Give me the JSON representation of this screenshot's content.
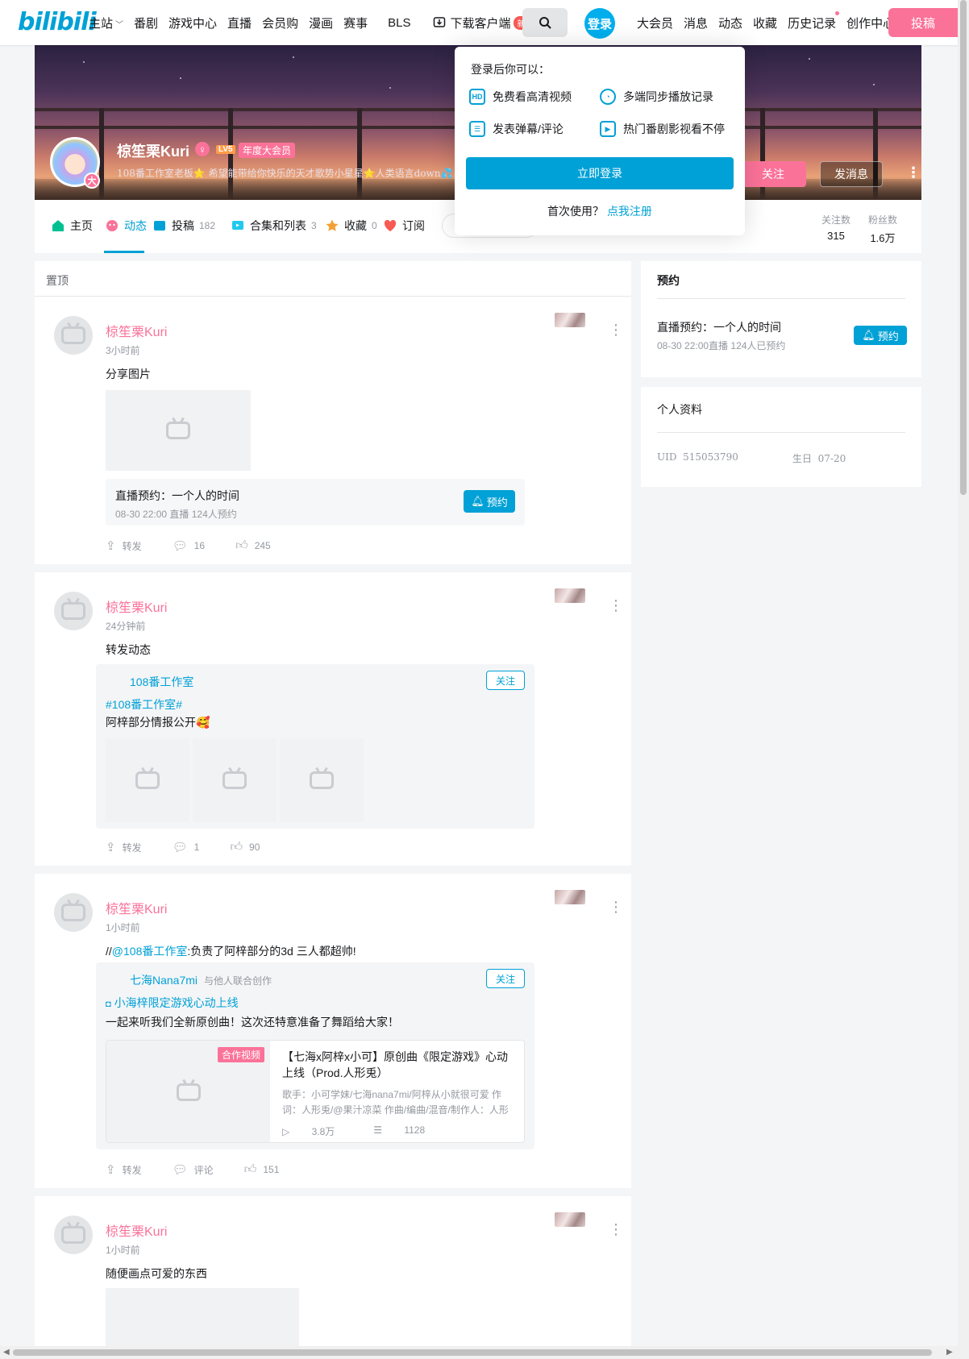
{
  "nav": {
    "logo": "bilibili",
    "left_items": [
      "主站",
      "番剧",
      "游戏中心",
      "直播",
      "会员购",
      "漫画",
      "赛事",
      "BLS"
    ],
    "download": "下载客户端",
    "new_badge": "新",
    "login": "登录",
    "right_items": [
      "大会员",
      "消息",
      "动态",
      "收藏",
      "历史记录",
      "创作中心"
    ],
    "upload": "投稿"
  },
  "profile": {
    "name": "椋笙栗Kuri",
    "level": "LV5",
    "vip": "年度大会员",
    "avatar_badge": "大",
    "sign": "108番工作室老板⭐ 希望能带给你快乐的天才歌势小星星⭐人类语言down💦 ♀",
    "follow_btn": "关注",
    "message_btn": "发消息"
  },
  "tabs": [
    {
      "label": "主页",
      "count": ""
    },
    {
      "label": "动态",
      "count": ""
    },
    {
      "label": "投稿",
      "count": "182"
    },
    {
      "label": "合集和列表",
      "count": "3"
    },
    {
      "label": "收藏",
      "count": "0"
    },
    {
      "label": "订阅",
      "count": ""
    }
  ],
  "stats": {
    "following_label": "关注数",
    "following": "315",
    "fans_label": "粉丝数",
    "fans": "1.6万"
  },
  "popover": {
    "title": "登录后你可以：",
    "features": [
      "免费看高清视频",
      "多端同步播放记录",
      "发表弹幕/评论",
      "热门番剧影视看不停"
    ],
    "login_btn": "立即登录",
    "first_use": "首次使用？",
    "register": "点我注册"
  },
  "feed": {
    "pinned_label": "置顶",
    "posts": [
      {
        "name": "椋笙栗Kuri",
        "time": "3小时前",
        "text": "分享图片",
        "reserve": {
          "title": "直播预约：一个人的时间",
          "sub": "08-30 22:00 直播     124人预约",
          "btn": "预约"
        },
        "actions": {
          "share": "转发",
          "comment": "16",
          "like": "245"
        }
      },
      {
        "name": "椋笙栗Kuri",
        "time": "24分钟前",
        "text": "转发动态",
        "repost": {
          "author": "108番工作室",
          "follow": "关注",
          "topic": "#108番工作室#",
          "body": "阿梓部分情报公开🥰"
        },
        "actions": {
          "share": "转发",
          "comment": "1",
          "like": "90"
        }
      },
      {
        "name": "椋笙栗Kuri",
        "time": "1小时前",
        "text_prefix": "//",
        "text_mention": "@108番工作室",
        "text_suffix": ":负责了阿梓部分的3d      三人都超帅!",
        "repost": {
          "author": "七海Nana7mi",
          "collab": "与他人联合创作",
          "follow": "关注",
          "topic": "小海梓限定游戏心动上线",
          "body": "一起来听我们全新原创曲！这次还特意准备了舞蹈给大家！",
          "video": {
            "badge": "合作视频",
            "title": "【七海x阿梓x小可】原创曲《限定游戏》心动上线（Prod.人形兎）",
            "desc": "歌手：小可学妹/七海nana7mi/阿梓从小就很可爱 作词：人形兎/@果汁凉菜 作曲/编曲/混音/制作人：人形兎",
            "plays": "3.8万",
            "danmaku": "1128"
          }
        },
        "actions": {
          "share": "转发",
          "comment": "评论",
          "like": "151"
        }
      },
      {
        "name": "椋笙栗Kuri",
        "time": "1小时前",
        "text": "随便画点可爱的东西"
      }
    ]
  },
  "sidebar": {
    "reserve_title": "预约",
    "reserve_item": "直播预约：一个人的时间",
    "reserve_sub": "08-30 22:00直播 124人已预约",
    "reserve_btn": "预约",
    "info_title": "个人资料",
    "uid_label": "UID",
    "uid": "515053790",
    "birthday_label": "生日",
    "birthday": "07-20"
  },
  "colors": {
    "brand_blue": "#00a1d6",
    "brand_pink": "#fb7299"
  }
}
